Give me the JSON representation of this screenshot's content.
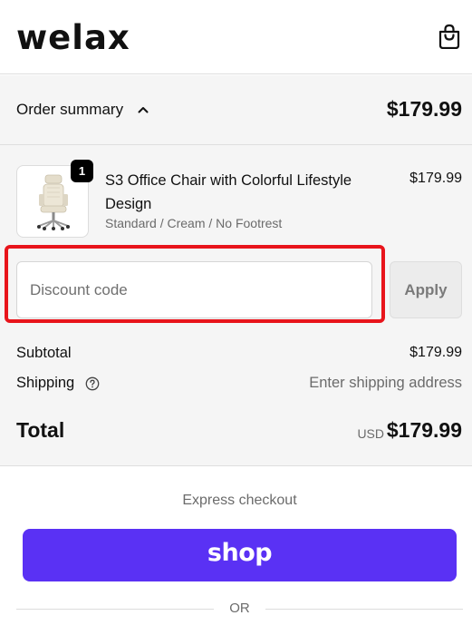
{
  "header": {
    "logo_text": "welax",
    "cart_icon": "shopping-bag-icon"
  },
  "order_summary": {
    "toggle_label": "Order summary",
    "toggle_icon": "chevron-up-icon",
    "total": "$179.99"
  },
  "product": {
    "quantity": "1",
    "name": "S3 Office Chair with Colorful Lifestyle Design",
    "variant": "Standard / Cream / No Footrest",
    "price": "$179.99",
    "image_icon": "office-chair-image"
  },
  "discount": {
    "placeholder": "Discount code",
    "value": "",
    "apply_label": "Apply"
  },
  "totals": {
    "subtotal_label": "Subtotal",
    "subtotal_value": "$179.99",
    "shipping_label": "Shipping",
    "shipping_icon": "question-circle-icon",
    "shipping_value": "Enter shipping address",
    "total_label": "Total",
    "currency": "USD",
    "total_value": "$179.99"
  },
  "checkout": {
    "express_label": "Express checkout",
    "shop_pay_label": "shop",
    "or_label": "OR"
  },
  "colors": {
    "shop_pay": "#5a31f4",
    "highlight": "#e8141b",
    "summary_bg": "#f5f5f5"
  }
}
